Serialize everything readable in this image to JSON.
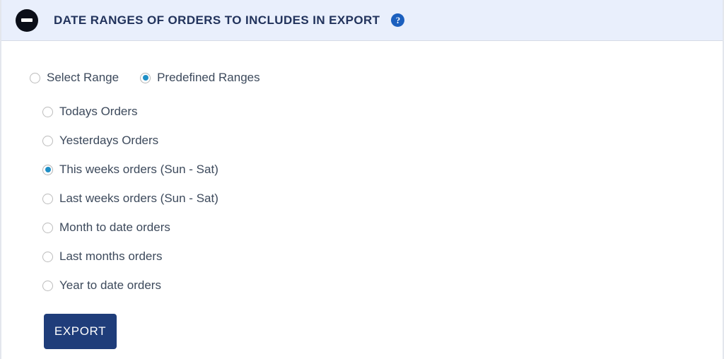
{
  "header": {
    "collapse_icon": "minus-circle-icon",
    "title": "DATE RANGES OF ORDERS TO INCLUDES IN EXPORT",
    "help_icon": "help-circle-icon",
    "help_glyph": "?",
    "background_color": "#e9effc",
    "title_color": "#22335c"
  },
  "mode_selector": {
    "options": [
      {
        "label": "Select Range",
        "selected": false
      },
      {
        "label": "Predefined Ranges",
        "selected": true
      }
    ]
  },
  "predefined_ranges": {
    "options": [
      {
        "label": "Todays Orders",
        "selected": false
      },
      {
        "label": "Yesterdays Orders",
        "selected": false
      },
      {
        "label": "This weeks orders (Sun - Sat)",
        "selected": true
      },
      {
        "label": "Last weeks orders (Sun - Sat)",
        "selected": false
      },
      {
        "label": "Month to date orders",
        "selected": false
      },
      {
        "label": "Last months orders",
        "selected": false
      },
      {
        "label": "Year to date orders",
        "selected": false
      }
    ]
  },
  "actions": {
    "export_label": "EXPORT",
    "export_color": "#1f3d7a"
  }
}
